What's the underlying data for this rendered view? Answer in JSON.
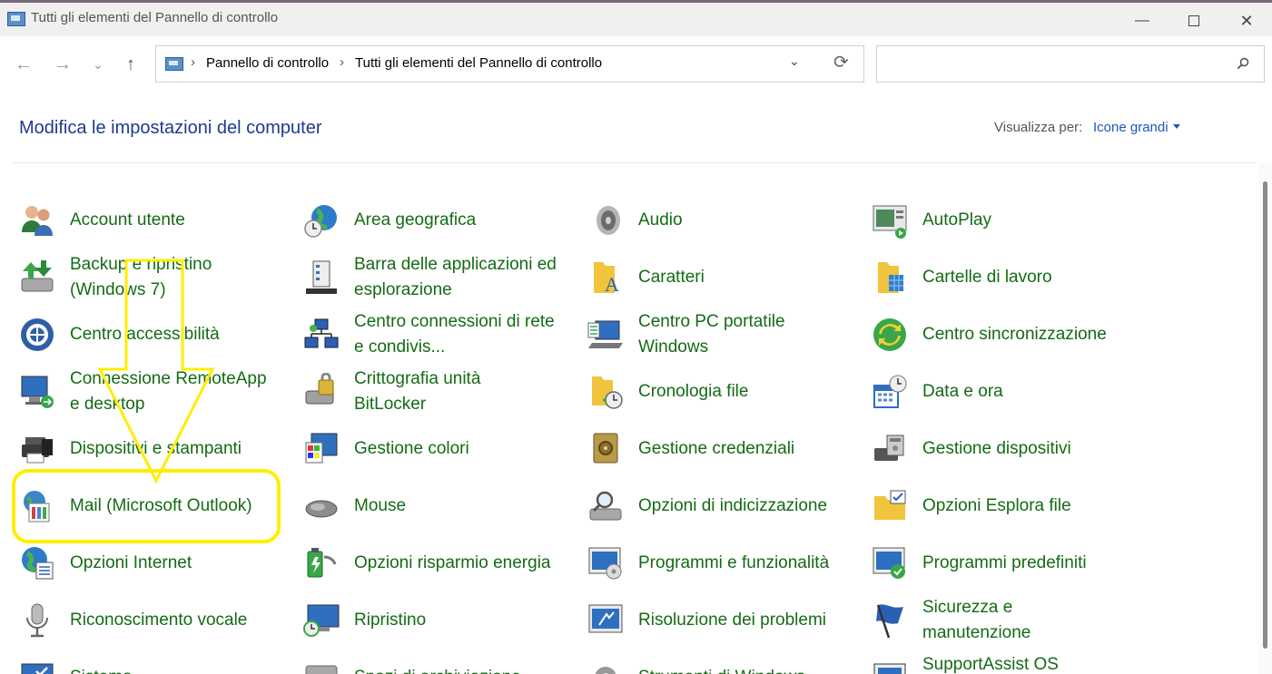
{
  "window": {
    "title": "Tutti gli elementi del Pannello di controllo",
    "minimize": "—",
    "close": "✕"
  },
  "nav": {
    "back": "←",
    "forward": "→",
    "recent": "⌄",
    "up": "↑",
    "refresh": "⟳",
    "dropdown": "⌄",
    "crumb_sep": "›",
    "breadcrumb": [
      "Pannello di controllo",
      "Tutti gli elementi del Pannello di controllo"
    ],
    "search_placeholder": ""
  },
  "header": {
    "title": "Modifica le impostazioni del computer",
    "view_label": "Visualizza per:",
    "view_value": "Icone grandi"
  },
  "items": [
    {
      "label": "Account utente",
      "icon": "users-icon"
    },
    {
      "label": "Area geografica",
      "icon": "globe-clock-icon"
    },
    {
      "label": "Audio",
      "icon": "speaker-icon"
    },
    {
      "label": "AutoPlay",
      "icon": "autoplay-icon"
    },
    {
      "label": "Backup e ripristino (Windows 7)",
      "icon": "backup-icon"
    },
    {
      "label": "Barra delle applicazioni ed esplorazione",
      "icon": "taskbar-icon"
    },
    {
      "label": "Caratteri",
      "icon": "fonts-folder-icon"
    },
    {
      "label": "Cartelle di lavoro",
      "icon": "work-folders-icon"
    },
    {
      "label": "Centro accessibilità",
      "icon": "accessibility-icon"
    },
    {
      "label": "Centro connessioni di rete e condivis...",
      "icon": "network-icon"
    },
    {
      "label": "Centro PC portatile Windows",
      "icon": "mobility-icon"
    },
    {
      "label": "Centro sincronizzazione",
      "icon": "sync-icon"
    },
    {
      "label": "Connessione RemoteApp e desktop",
      "icon": "remoteapp-icon"
    },
    {
      "label": "Crittografia unità BitLocker",
      "icon": "bitlocker-icon"
    },
    {
      "label": "Cronologia file",
      "icon": "file-history-icon"
    },
    {
      "label": "Data e ora",
      "icon": "date-time-icon"
    },
    {
      "label": "Dispositivi e stampanti",
      "icon": "printer-icon"
    },
    {
      "label": "Gestione colori",
      "icon": "color-management-icon"
    },
    {
      "label": "Gestione credenziali",
      "icon": "credential-vault-icon"
    },
    {
      "label": "Gestione dispositivi",
      "icon": "device-manager-icon"
    },
    {
      "label": "Mail (Microsoft Outlook)",
      "icon": "mail-icon"
    },
    {
      "label": "Mouse",
      "icon": "mouse-icon"
    },
    {
      "label": "Opzioni di indicizzazione",
      "icon": "indexing-icon"
    },
    {
      "label": "Opzioni Esplora file",
      "icon": "folder-options-icon"
    },
    {
      "label": "Opzioni Internet",
      "icon": "internet-options-icon"
    },
    {
      "label": "Opzioni risparmio energia",
      "icon": "power-options-icon"
    },
    {
      "label": "Programmi e funzionalità",
      "icon": "programs-icon"
    },
    {
      "label": "Programmi predefiniti",
      "icon": "default-programs-icon"
    },
    {
      "label": "Riconoscimento vocale",
      "icon": "microphone-icon"
    },
    {
      "label": "Ripristino",
      "icon": "recovery-icon"
    },
    {
      "label": "Risoluzione dei problemi",
      "icon": "troubleshooting-icon"
    },
    {
      "label": "Sicurezza e manutenzione",
      "icon": "security-flag-icon"
    },
    {
      "label": "Sistema",
      "icon": "system-icon"
    },
    {
      "label": "Spazi di archiviazione",
      "icon": "storage-spaces-icon"
    },
    {
      "label": "Strumenti di Windows",
      "icon": "windows-tools-icon"
    },
    {
      "label": "SupportAssist OS Recovery",
      "icon": "supportassist-icon"
    }
  ],
  "annotation": {
    "highlight_color": "#ffee00"
  }
}
